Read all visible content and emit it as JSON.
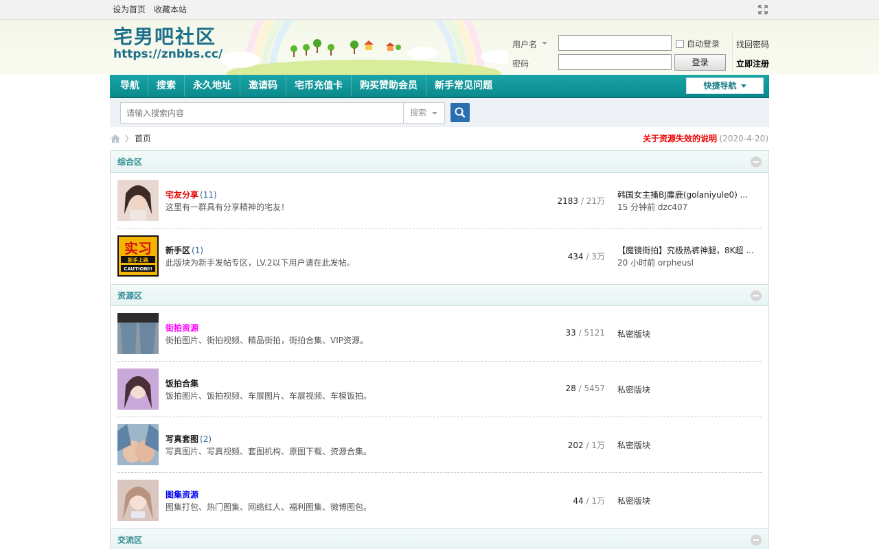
{
  "topbar": {
    "set_home": "设为首页",
    "bookmark": "收藏本站"
  },
  "logo": {
    "cn": "宅男吧社区",
    "url": "https://znbbs.cc/"
  },
  "login": {
    "username_label": "用户名",
    "password_label": "密码",
    "auto_login": "自动登录",
    "login_button": "登录",
    "find_password": "找回密码",
    "register": "立即注册"
  },
  "nav": {
    "items": [
      "导航",
      "搜索",
      "永久地址",
      "邀请码",
      "宅币充值卡",
      "购买赞助会员",
      "新手常见问题"
    ],
    "quick": "快捷导航"
  },
  "search": {
    "placeholder": "请输入搜索内容",
    "type": "搜索"
  },
  "breadcrumb": {
    "home": "首页",
    "notice": "关于资源失效的说明",
    "notice_date": "(2020-4-20)"
  },
  "categories": [
    {
      "title": "综合区",
      "forums": [
        {
          "name": "宅友分享",
          "name_color": "#e60000",
          "count": "(11)",
          "desc": "这里有一群具有分享精神的宅友！",
          "threads": "2183",
          "posts": " / 21万",
          "last_title": "韩国女主播BJ麋鹿(golaniyule0) ...",
          "last_meta": "15 分钟前 dzc407"
        },
        {
          "name": "新手区",
          "name_color": "#222222",
          "count": "(1)",
          "desc": "此版块为新手发帖专区，LV.2以下用户请在此发帖。",
          "threads": "434",
          "posts": " / 3万",
          "last_title": "【魔镜街拍】究极热裤神腿，8K超 ...",
          "last_meta": "20 小时前 orpheusl"
        }
      ]
    },
    {
      "title": "资源区",
      "forums": [
        {
          "name": "街拍资源",
          "name_color": "#ff00ff",
          "count": "",
          "desc": "街拍图片、街拍视频、精品街拍，街拍合集、VIP资源。",
          "threads": "33",
          "posts": " / 5121",
          "private": "私密版块"
        },
        {
          "name": "饭拍合集",
          "name_color": "#222222",
          "count": "",
          "desc": "饭拍图片、饭拍视频、车展图片、车展视频、车模饭拍。",
          "threads": "28",
          "posts": " / 5457",
          "private": "私密版块"
        },
        {
          "name": "写真套图",
          "name_color": "#222222",
          "count": "(2)",
          "desc": "写真图片、写真视频、套图机构、原图下载、资源合集。",
          "threads": "202",
          "posts": " / 1万",
          "private": "私密版块"
        },
        {
          "name": "图集资源",
          "name_color": "#0000ee",
          "count": "",
          "desc": "图集打包、热门图集、网络红人、福利图集、微博图包。",
          "threads": "44",
          "posts": " / 1万",
          "private": "私密版块"
        }
      ]
    },
    {
      "title": "交流区",
      "forums": []
    }
  ]
}
